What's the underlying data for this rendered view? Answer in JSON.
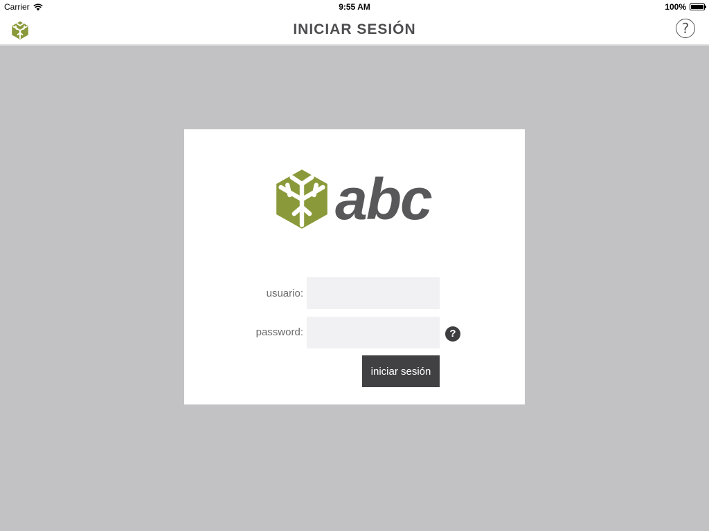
{
  "status_bar": {
    "carrier": "Carrier",
    "time": "9:55 AM",
    "battery_text": "100%",
    "battery_level": 1.0,
    "wifi_icon": "wifi-icon",
    "battery_icon": "battery-icon"
  },
  "nav": {
    "title": "INICIAR SESIÓN",
    "logo_icon": "abc-hexagon-logo-icon",
    "help_icon": "help-circle-icon",
    "help_symbol": "?"
  },
  "login": {
    "brand": "abc",
    "username_label": "usuario:",
    "username_value": "",
    "password_label": "password:",
    "password_value": "",
    "password_help_symbol": "?",
    "submit_label": "iniciar sesión"
  },
  "colors": {
    "background": "#c2c1c4",
    "brand_green": "#8a9a3a",
    "brand_text": "#58585a",
    "button": "#414042",
    "input_bg": "#f1f0f3"
  }
}
